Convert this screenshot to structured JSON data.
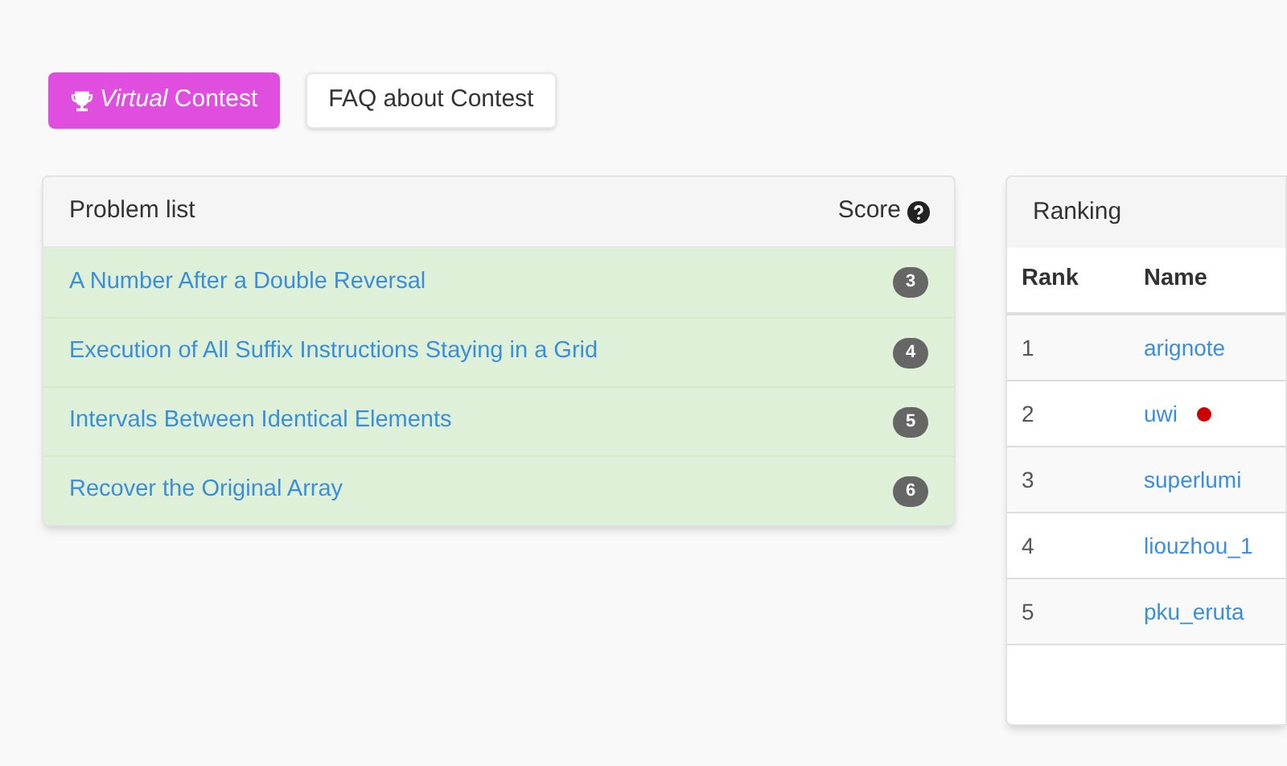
{
  "buttons": [
    {
      "kind": "primary",
      "label": "*Virtual* Contest"
    },
    {
      "kind": "secondary",
      "label": "FAQ about Contest"
    }
  ],
  "problem_list": {
    "title": "Problem list",
    "score_label": "Score",
    "problems": [
      {
        "title": "A Number After a Double Reversal",
        "score": "3"
      },
      {
        "title": "Execution of All Suffix Instructions Staying in a Grid",
        "score": "4"
      },
      {
        "title": "Intervals Between Identical Elements",
        "score": "5"
      },
      {
        "title": "Recover the Original Array",
        "score": "6"
      }
    ]
  },
  "ranking": {
    "title": "Ranking",
    "columns": [
      "Rank",
      "Name"
    ],
    "rows": [
      {
        "rank": "1",
        "name": "arignote",
        "dot": false
      },
      {
        "rank": "2",
        "name": "uwi",
        "dot": true
      },
      {
        "rank": "3",
        "name": "superlumi",
        "dot": false
      },
      {
        "rank": "4",
        "name": "liouzhou_1",
        "dot": false
      },
      {
        "rank": "5",
        "name": "pku_eruta",
        "dot": false
      }
    ]
  }
}
